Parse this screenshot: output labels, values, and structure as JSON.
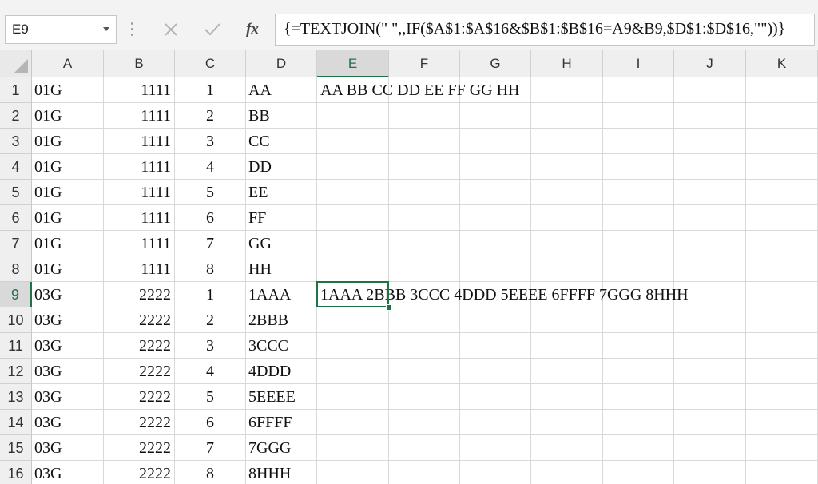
{
  "formula_bar": {
    "name_box": "E9",
    "cancel_icon": "close-icon",
    "enter_icon": "check-icon",
    "fx_label": "fx",
    "formula": "{=TEXTJOIN(\" \",,IF($A$1:$A$16&$B$1:$B$16=A9&B9,$D$1:$D$16,\"\"))}"
  },
  "columns": [
    "A",
    "B",
    "C",
    "D",
    "E",
    "F",
    "G",
    "H",
    "I",
    "J",
    "K"
  ],
  "selected_column": "E",
  "selected_row": "9",
  "rows": [
    {
      "num": "1",
      "A": "01G",
      "B": "1111",
      "C": "1",
      "D": "AA",
      "E": "AA BB CC DD EE FF GG HH"
    },
    {
      "num": "2",
      "A": "01G",
      "B": "1111",
      "C": "2",
      "D": "BB",
      "E": ""
    },
    {
      "num": "3",
      "A": "01G",
      "B": "1111",
      "C": "3",
      "D": "CC",
      "E": ""
    },
    {
      "num": "4",
      "A": "01G",
      "B": "1111",
      "C": "4",
      "D": "DD",
      "E": ""
    },
    {
      "num": "5",
      "A": "01G",
      "B": "1111",
      "C": "5",
      "D": "EE",
      "E": ""
    },
    {
      "num": "6",
      "A": "01G",
      "B": "1111",
      "C": "6",
      "D": "FF",
      "E": ""
    },
    {
      "num": "7",
      "A": "01G",
      "B": "1111",
      "C": "7",
      "D": "GG",
      "E": ""
    },
    {
      "num": "8",
      "A": "01G",
      "B": "1111",
      "C": "8",
      "D": "HH",
      "E": ""
    },
    {
      "num": "9",
      "A": "03G",
      "B": "2222",
      "C": "1",
      "D": "1AAA",
      "E": "1AAA 2BBB 3CCC 4DDD 5EEEE 6FFFF 7GGG 8HHH"
    },
    {
      "num": "10",
      "A": "03G",
      "B": "2222",
      "C": "2",
      "D": "2BBB",
      "E": ""
    },
    {
      "num": "11",
      "A": "03G",
      "B": "2222",
      "C": "3",
      "D": "3CCC",
      "E": ""
    },
    {
      "num": "12",
      "A": "03G",
      "B": "2222",
      "C": "4",
      "D": "4DDD",
      "E": ""
    },
    {
      "num": "13",
      "A": "03G",
      "B": "2222",
      "C": "5",
      "D": "5EEEE",
      "E": ""
    },
    {
      "num": "14",
      "A": "03G",
      "B": "2222",
      "C": "6",
      "D": "6FFFF",
      "E": ""
    },
    {
      "num": "15",
      "A": "03G",
      "B": "2222",
      "C": "7",
      "D": "7GGG",
      "E": ""
    },
    {
      "num": "16",
      "A": "03G",
      "B": "2222",
      "C": "8",
      "D": "8HHH",
      "E": ""
    }
  ],
  "colors": {
    "accent": "#217346"
  }
}
